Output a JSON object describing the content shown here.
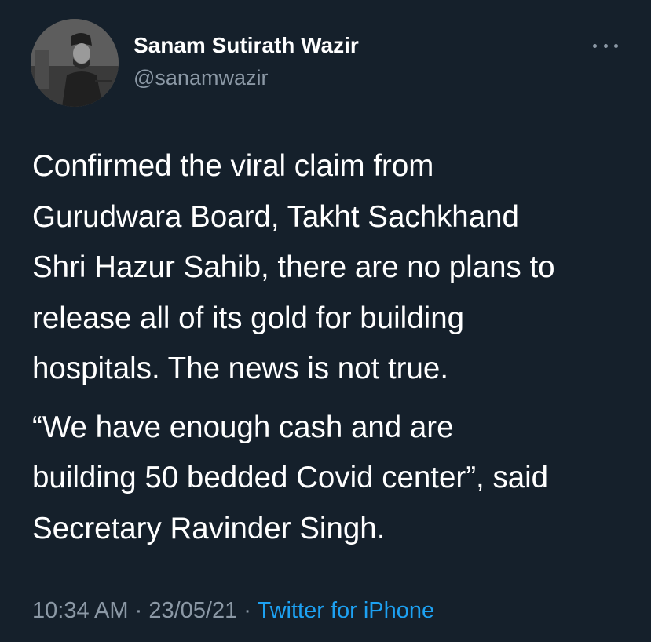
{
  "author": {
    "display_name": "Sanam Sutirath Wazir",
    "handle": "@sanamwazir",
    "avatar_icon": "profile-photo"
  },
  "more_icon": "more-horizontal-icon",
  "tweet": {
    "paragraph_1": "Confirmed the viral claim from\nGurudwara Board, Takht Sachkhand\nShri Hazur Sahib, there are no plans to\nrelease all of its gold for building\nhospitals. The news is not true.",
    "paragraph_2": "“We have enough cash and are\nbuilding 50 bedded Covid center”, said\nSecretary Ravinder Singh."
  },
  "meta": {
    "time": "10:34 AM",
    "separator": "·",
    "date": "23/05/21",
    "source": "Twitter for iPhone"
  },
  "colors": {
    "background": "#15202b",
    "primary_text": "#ffffff",
    "secondary_text": "#8b98a5",
    "link": "#1da1f2"
  }
}
